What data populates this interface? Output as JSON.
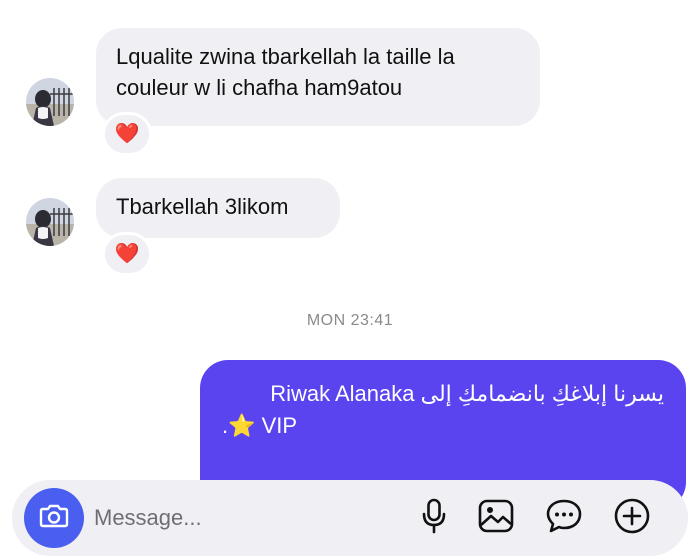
{
  "messages": [
    {
      "direction": "incoming",
      "lines": [
        "Lqualite zwina tbarkellah la taille la",
        "couleur w li chafha ham9atou"
      ],
      "reaction": "❤️"
    },
    {
      "direction": "incoming",
      "lines": [
        "Tbarkellah 3likom"
      ],
      "reaction": "❤️"
    }
  ],
  "timestamp": "MON 23:41",
  "outgoing": {
    "line1": "يسرنا إبلاغكِ بانضمامكِ إلى Riwak Alanaka",
    "line2": ".⭐ VIP"
  },
  "composer": {
    "placeholder": "Message...",
    "icons": [
      "camera-icon",
      "microphone-icon",
      "image-icon",
      "chat-bubble-icon",
      "plus-circle-icon"
    ]
  },
  "colors": {
    "incoming_bubble": "#efeff4",
    "outgoing_bubble": "#5a44f0",
    "camera_button": "#4a5ff0",
    "timestamp_text": "#8a8a8e"
  }
}
